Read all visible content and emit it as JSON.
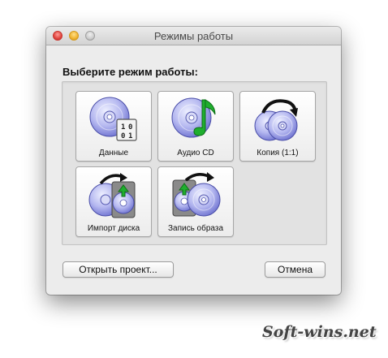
{
  "window": {
    "title": "Режимы работы",
    "prompt": "Выберите режим работы:"
  },
  "modes": [
    {
      "label": "Данные",
      "icon": "disc-binary-data-icon"
    },
    {
      "label": "Аудио CD",
      "icon": "disc-music-note-icon"
    },
    {
      "label": "Копия (1:1)",
      "icon": "disc-copy-icon"
    },
    {
      "label": "Импорт диска",
      "icon": "disc-import-icon"
    },
    {
      "label": "Запись образа",
      "icon": "disc-burn-image-icon"
    }
  ],
  "data_icon_digits": [
    "1",
    "0",
    "0",
    "1"
  ],
  "buttons": {
    "open_project": "Открыть проект...",
    "cancel": "Отмена"
  },
  "watermark": "Soft-wins.net",
  "colors": {
    "disc_blue": "#7b7fd6",
    "note_green": "#1fae2e",
    "arrow_black": "#111111",
    "close": "#e0443e",
    "minimize": "#f0b330"
  }
}
